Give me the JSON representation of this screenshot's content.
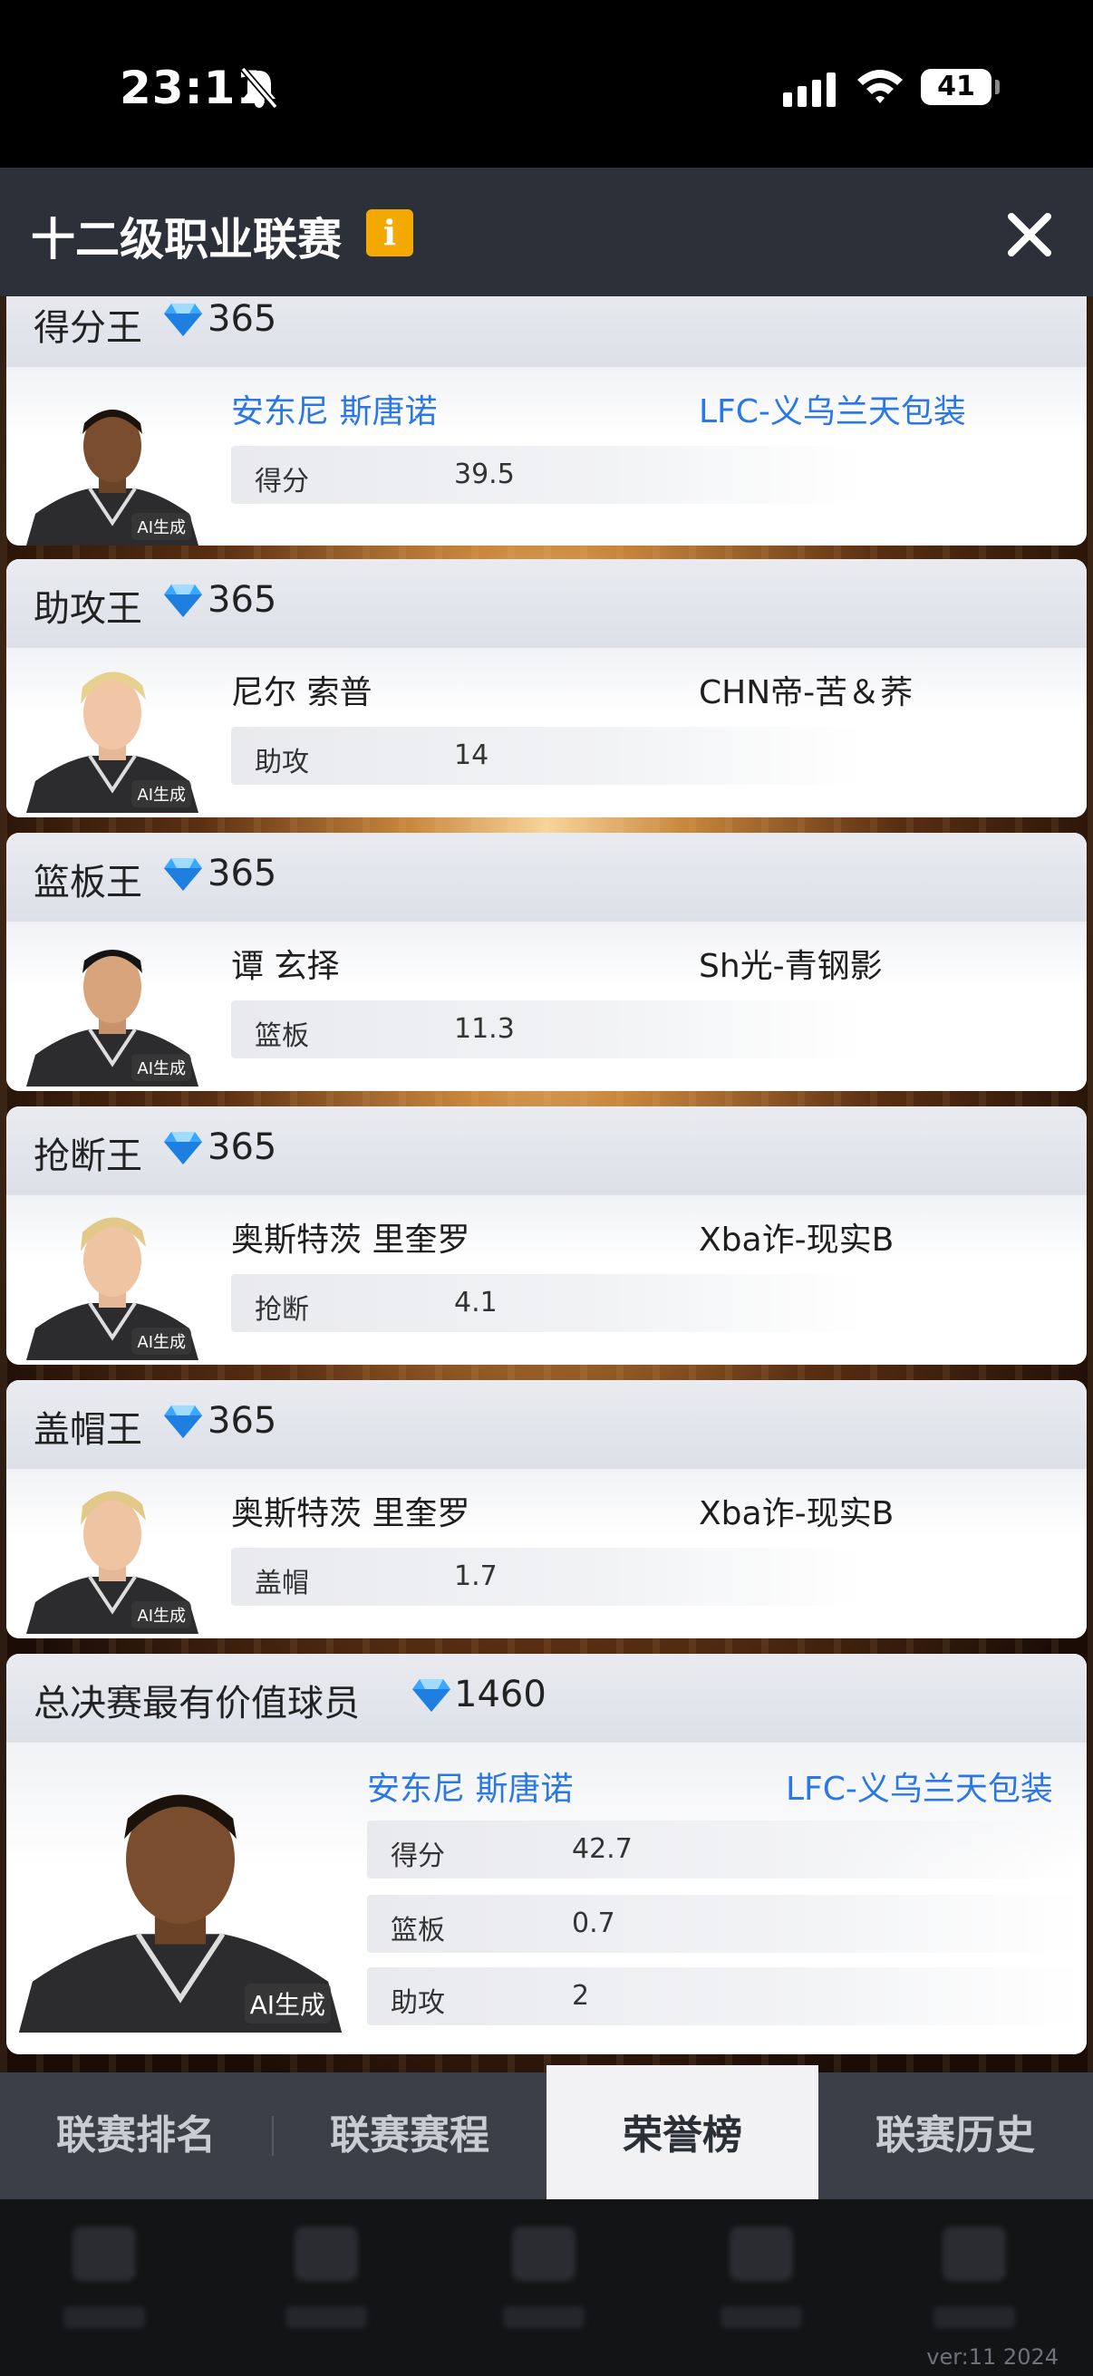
{
  "status_bar": {
    "time": "23:11",
    "battery": "41"
  },
  "header": {
    "title": "十二级职业联赛",
    "info_label": "i"
  },
  "awards": [
    {
      "title": "得分王",
      "reward": "365",
      "player": "安东尼 斯唐诺",
      "team": "LFC-义乌兰天包装",
      "name_color": "blue",
      "stat_label": "得分",
      "stat_value": "39.5",
      "ai_tag": "AI生成"
    },
    {
      "title": "助攻王",
      "reward": "365",
      "player": "尼尔 索普",
      "team": "CHN帝-苦＆荞",
      "name_color": "dark",
      "stat_label": "助攻",
      "stat_value": "14",
      "ai_tag": "AI生成"
    },
    {
      "title": "篮板王",
      "reward": "365",
      "player": "谭 玄择",
      "team": "Sh光-青钢影",
      "name_color": "dark",
      "stat_label": "篮板",
      "stat_value": "11.3",
      "ai_tag": "AI生成"
    },
    {
      "title": "抢断王",
      "reward": "365",
      "player": "奥斯特茨 里奎罗",
      "team": "Xba诈-现实B",
      "name_color": "dark",
      "stat_label": "抢断",
      "stat_value": "4.1",
      "ai_tag": "AI生成"
    },
    {
      "title": "盖帽王",
      "reward": "365",
      "player": "奥斯特茨 里奎罗",
      "team": "Xba诈-现实B",
      "name_color": "dark",
      "stat_label": "盖帽",
      "stat_value": "1.7",
      "ai_tag": "AI生成"
    }
  ],
  "mvp": {
    "title": "总决赛最有价值球员",
    "reward": "1460",
    "player": "安东尼 斯唐诺",
    "team": "LFC-义乌兰天包装",
    "ai_tag": "AI生成",
    "stats": [
      {
        "label": "得分",
        "value": "42.7"
      },
      {
        "label": "篮板",
        "value": "0.7"
      },
      {
        "label": "助攻",
        "value": "2"
      }
    ]
  },
  "tabs": [
    "联赛排名",
    "联赛赛程",
    "荣誉榜",
    "联赛历史"
  ],
  "active_tab": "荣誉榜",
  "version": "ver:11  2024",
  "colors": {
    "accent_blue": "#2a78e8",
    "info_yellow": "#f4a900",
    "diamond": "#3aa8ff"
  }
}
